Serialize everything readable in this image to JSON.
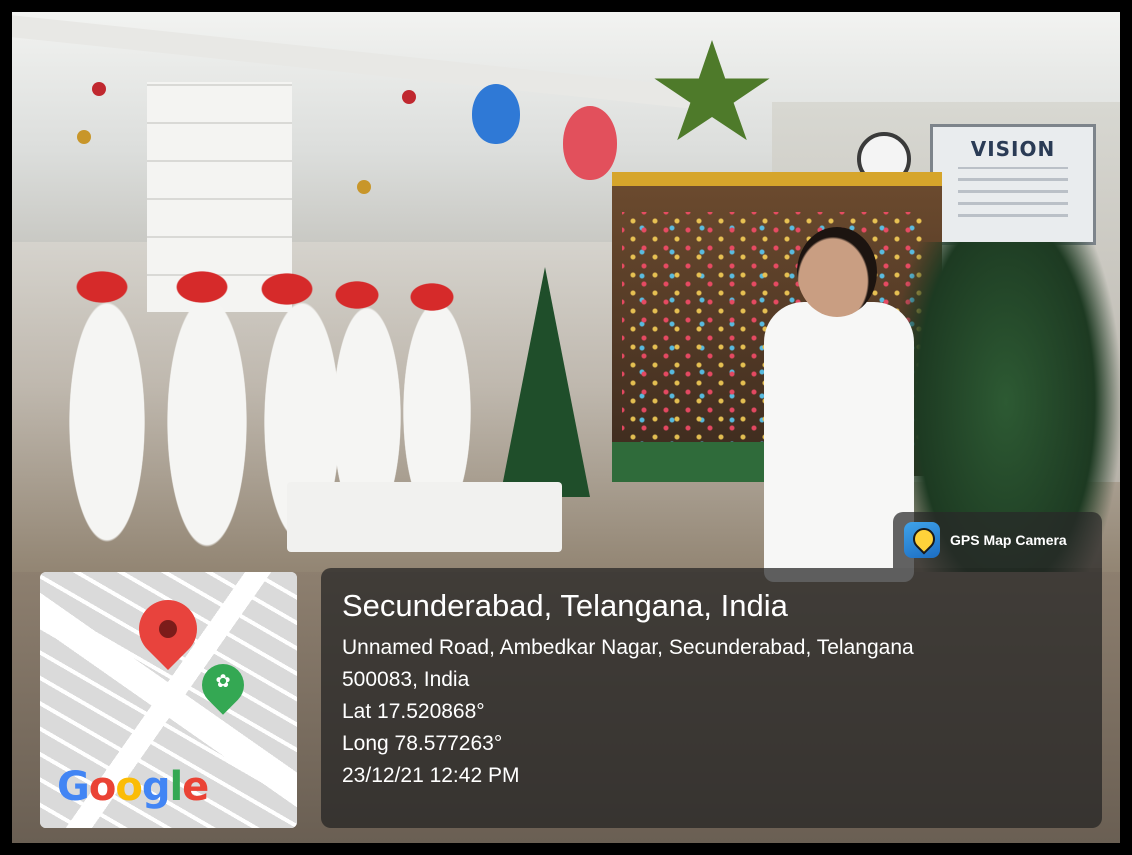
{
  "photo": {
    "scene": "christmas-celebration-photo",
    "sign_text": "VISION"
  },
  "gps_badge": {
    "app_name": "GPS Map Camera",
    "icon": "gps-map-camera-icon"
  },
  "location": {
    "title": "Secunderabad, Telangana, India",
    "address_line_1": "Unnamed Road, Ambedkar Nagar, Secunderabad, Telangana",
    "address_line_2": "500083, India",
    "latitude": "Lat 17.520868°",
    "longitude": "Long 78.577263°",
    "datetime": "23/12/21 12:42 PM"
  },
  "map": {
    "logo_letters": [
      "G",
      "o",
      "o",
      "g",
      "l",
      "e"
    ],
    "pin_color": "#e8433d",
    "place_pin_color": "#34a853"
  },
  "colors": {
    "overlay": "#232323",
    "text": "#ffffff"
  }
}
